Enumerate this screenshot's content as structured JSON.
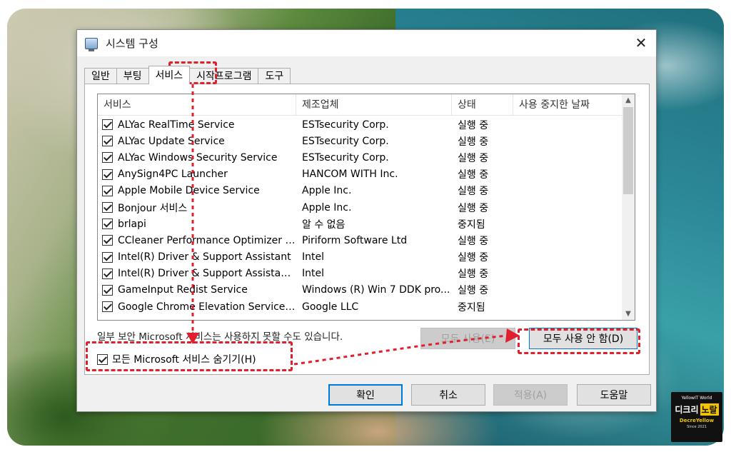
{
  "window": {
    "title": "시스템 구성",
    "close_glyph": "✕"
  },
  "tabs": [
    {
      "label": "일반"
    },
    {
      "label": "부팅"
    },
    {
      "label": "서비스"
    },
    {
      "label": "시작프로그램"
    },
    {
      "label": "도구"
    }
  ],
  "active_tab": "서비스",
  "services": {
    "columns": [
      "서비스",
      "제조업체",
      "상태",
      "사용 중지한 날짜"
    ],
    "rows": [
      {
        "name": "ALYac RealTime Service",
        "maker": "ESTsecurity Corp.",
        "status": "실행 중",
        "checked": true
      },
      {
        "name": "ALYac Update Service",
        "maker": "ESTsecurity Corp.",
        "status": "실행 중",
        "checked": true
      },
      {
        "name": "ALYac Windows Security Service",
        "maker": "ESTsecurity Corp.",
        "status": "실행 중",
        "checked": true
      },
      {
        "name": "AnySign4PC Launcher",
        "maker": "HANCOM WITH Inc.",
        "status": "실행 중",
        "checked": true
      },
      {
        "name": "Apple Mobile Device Service",
        "maker": "Apple Inc.",
        "status": "실행 중",
        "checked": true
      },
      {
        "name": "Bonjour 서비스",
        "maker": "Apple Inc.",
        "status": "실행 중",
        "checked": true
      },
      {
        "name": "brlapi",
        "maker": "알 수 없음",
        "status": "중지됨",
        "checked": true
      },
      {
        "name": "CCleaner Performance Optimizer S...",
        "maker": "Piriform Software Ltd",
        "status": "실행 중",
        "checked": true
      },
      {
        "name": "Intel(R) Driver & Support Assistant",
        "maker": "Intel",
        "status": "실행 중",
        "checked": true
      },
      {
        "name": "Intel(R) Driver & Support Assistant ...",
        "maker": "Intel",
        "status": "실행 중",
        "checked": true
      },
      {
        "name": "GameInput Redist Service",
        "maker": "Windows (R) Win 7 DDK pro...",
        "status": "실행 중",
        "checked": true
      },
      {
        "name": "Google Chrome Elevation Service (...",
        "maker": "Google LLC",
        "status": "중지됨",
        "checked": true
      }
    ]
  },
  "note": "일부 보안 Microsoft 서비스는 사용하지 못할 수도 있습니다.",
  "hide_ms": {
    "label": "모든 Microsoft 서비스 숨기기(H)",
    "checked": true
  },
  "buttons": {
    "enable_all": "모두 사용(E)",
    "disable_all": "모두 사용 안 함(D)",
    "ok": "확인",
    "cancel": "취소",
    "apply": "적용(A)",
    "help": "도움말"
  },
  "colors": {
    "annotation": "#e0202c",
    "focus": "#0078d7"
  },
  "logo": {
    "line1": "YellowIT World",
    "word_a": "디크리",
    "word_b": "노랄",
    "line3": "DecreYellow",
    "line4": "Since 2021"
  }
}
